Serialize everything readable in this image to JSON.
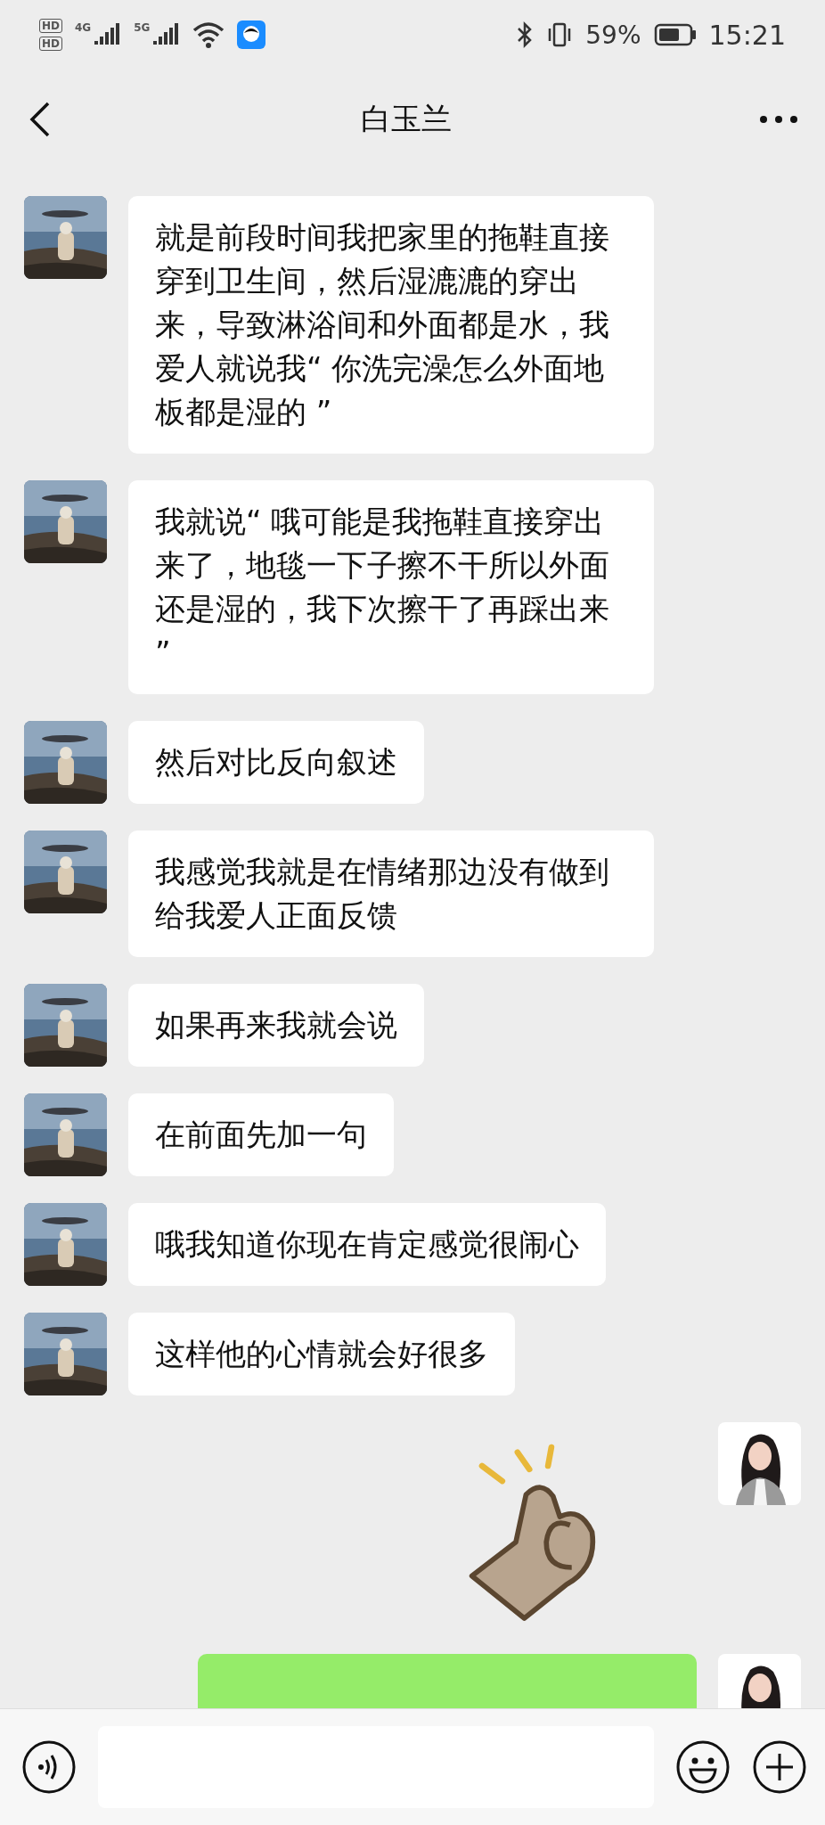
{
  "status_bar": {
    "sim_badges": [
      "HD",
      "HD"
    ],
    "signals": [
      {
        "label": "4G"
      },
      {
        "label": "5G"
      }
    ],
    "battery": "59%",
    "time": "15:21"
  },
  "header": {
    "title": "白玉兰"
  },
  "messages": [
    {
      "outgoing": false,
      "kind": "text",
      "text": "就是前段时间我把家里的拖鞋直接穿到卫生间，然后湿漉漉的穿出来，导致淋浴间和外面都是水，我爱人就说我“ 你洗完澡怎么外面地板都是湿的 ”"
    },
    {
      "outgoing": false,
      "kind": "text",
      "text": "我就说“ 哦可能是我拖鞋直接穿出来了，地毯一下子擦不干所以外面还是湿的，我下次擦干了再踩出来 ”"
    },
    {
      "outgoing": false,
      "kind": "text",
      "text": "然后对比反向叙述"
    },
    {
      "outgoing": false,
      "kind": "text",
      "text": "我感觉我就是在情绪那边没有做到给我爱人正面反馈"
    },
    {
      "outgoing": false,
      "kind": "text",
      "text": "如果再来我就会说"
    },
    {
      "outgoing": false,
      "kind": "text",
      "text": "在前面先加一句"
    },
    {
      "outgoing": false,
      "kind": "text",
      "text": "哦我知道你现在肯定感觉很闹心"
    },
    {
      "outgoing": false,
      "kind": "text",
      "text": "这样他的心情就会好很多"
    },
    {
      "outgoing": true,
      "kind": "sticker"
    },
    {
      "outgoing": true,
      "kind": "cut"
    }
  ]
}
